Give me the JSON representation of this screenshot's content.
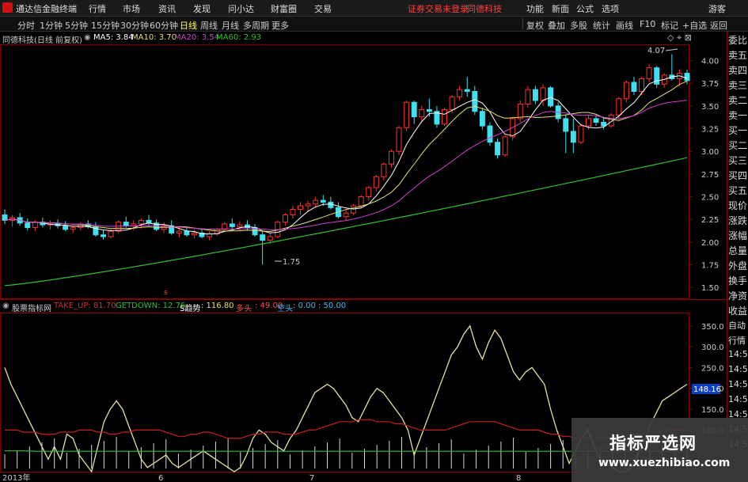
{
  "titlebar": {
    "app_name": "通达信金融终端",
    "menu": [
      "行情",
      "市场",
      "资讯",
      "发现",
      "问小达",
      "财富圈",
      "交易"
    ],
    "notice": "证券交易未登录",
    "stock": "同德科技",
    "right_menu": [
      "功能",
      "新面",
      "公式",
      "选项"
    ],
    "guest": "游客",
    "accent": "#d01010"
  },
  "toolbar": {
    "periods": [
      "分时",
      "1分钟",
      "5分钟",
      "15分钟",
      "30分钟",
      "60分钟",
      "日线",
      "周线",
      "月线",
      "多周期",
      "更多"
    ],
    "active": "日线",
    "right": [
      "复权",
      "叠加",
      "多股",
      "统计",
      "画线",
      "F10",
      "标记",
      "+自选",
      "返回"
    ]
  },
  "main_legend": {
    "title": "同德科技(日线 前复权)",
    "ma5": "MA5: 3.84",
    "ma10": "MA10: 3.70",
    "ma20": "MA20: 3.54",
    "ma60": "MA60: 2.93",
    "colors": {
      "ma5": "#ffffff",
      "ma10": "#e8e070",
      "ma20": "#d040d0",
      "ma60": "#30c030"
    }
  },
  "indicator_legend": {
    "title": "股票指标网",
    "take_up": "TAKE_UP: 81.70",
    "getdown": "GETDOWN: 12.76",
    "trend_label": "S趋势",
    "trend": ": 116.80",
    "duotou_label": "多头",
    "duotou": ": 49.00",
    "kongtou_label": "空头",
    "kongtou": ": 0.00 : 50.00"
  },
  "annotations": {
    "high": "4.07",
    "low": "1.75",
    "price_tag": "148.16"
  },
  "x_labels": [
    "2013年",
    "6",
    "7",
    "8"
  ],
  "right_panel": [
    "委比",
    "卖五",
    "卖四",
    "卖三",
    "卖二",
    "卖一",
    "买一",
    "买二",
    "买三",
    "买四",
    "买五",
    "现价",
    "涨跌",
    "涨幅",
    "总量",
    "外盘",
    "换手",
    "净资",
    "收益",
    "自动",
    "行情",
    "14:5",
    "14:5",
    "14:5",
    "14:5",
    "14:5",
    "14:5",
    "14:5"
  ],
  "banner": {
    "line1": "指标严选网",
    "line2": "www.xuezhibiao.com"
  },
  "chart_data": [
    {
      "type": "candlestick",
      "yaxis_ticks": [
        "4.00",
        "3.75",
        "3.50",
        "3.25",
        "3.00",
        "2.75",
        "2.50",
        "2.25",
        "2.00",
        "1.75",
        "1.50"
      ],
      "ylim": [
        1.38,
        4.17
      ],
      "ohlc": [
        [
          2.3,
          2.36,
          2.2,
          2.24
        ],
        [
          2.24,
          2.3,
          2.17,
          2.27
        ],
        [
          2.27,
          2.32,
          2.18,
          2.21
        ],
        [
          2.21,
          2.26,
          2.13,
          2.16
        ],
        [
          2.16,
          2.24,
          2.12,
          2.22
        ],
        [
          2.22,
          2.27,
          2.16,
          2.19
        ],
        [
          2.19,
          2.24,
          2.14,
          2.2
        ],
        [
          2.2,
          2.25,
          2.15,
          2.18
        ],
        [
          2.18,
          2.23,
          2.12,
          2.14
        ],
        [
          2.14,
          2.18,
          2.1,
          2.16
        ],
        [
          2.16,
          2.22,
          2.13,
          2.2
        ],
        [
          2.2,
          2.24,
          2.15,
          2.17
        ],
        [
          2.17,
          2.22,
          2.06,
          2.08
        ],
        [
          2.08,
          2.13,
          2.03,
          2.06
        ],
        [
          2.06,
          2.14,
          2.04,
          2.12
        ],
        [
          2.12,
          2.24,
          2.1,
          2.22
        ],
        [
          2.22,
          2.28,
          2.16,
          2.18
        ],
        [
          2.18,
          2.24,
          2.13,
          2.2
        ],
        [
          2.2,
          2.26,
          2.15,
          2.24
        ],
        [
          2.24,
          2.3,
          2.18,
          2.21
        ],
        [
          2.21,
          2.25,
          2.12,
          2.14
        ],
        [
          2.14,
          2.22,
          2.1,
          2.18
        ],
        [
          2.18,
          2.24,
          2.08,
          2.1
        ],
        [
          2.1,
          2.16,
          2.05,
          2.12
        ],
        [
          2.12,
          2.17,
          2.06,
          2.08
        ],
        [
          2.08,
          2.14,
          2.04,
          2.1
        ],
        [
          2.1,
          2.15,
          2.04,
          2.06
        ],
        [
          2.06,
          2.12,
          2.02,
          2.09
        ],
        [
          2.09,
          2.16,
          2.07,
          2.14
        ],
        [
          2.14,
          2.22,
          2.12,
          2.2
        ],
        [
          2.2,
          2.26,
          2.14,
          2.17
        ],
        [
          2.17,
          2.23,
          2.12,
          2.19
        ],
        [
          2.19,
          2.24,
          2.13,
          2.16
        ],
        [
          2.16,
          2.2,
          2.06,
          2.08
        ],
        [
          2.08,
          2.13,
          1.75,
          2.02
        ],
        [
          2.02,
          2.1,
          1.98,
          2.06
        ],
        [
          2.06,
          2.24,
          2.04,
          2.22
        ],
        [
          2.22,
          2.32,
          2.18,
          2.3
        ],
        [
          2.3,
          2.4,
          2.26,
          2.36
        ],
        [
          2.36,
          2.44,
          2.3,
          2.4
        ],
        [
          2.4,
          2.46,
          2.34,
          2.42
        ],
        [
          2.42,
          2.5,
          2.38,
          2.46
        ],
        [
          2.46,
          2.52,
          2.4,
          2.44
        ],
        [
          2.44,
          2.5,
          2.36,
          2.38
        ],
        [
          2.38,
          2.44,
          2.26,
          2.28
        ],
        [
          2.28,
          2.36,
          2.24,
          2.32
        ],
        [
          2.32,
          2.42,
          2.3,
          2.4
        ],
        [
          2.4,
          2.52,
          2.38,
          2.5
        ],
        [
          2.5,
          2.62,
          2.46,
          2.6
        ],
        [
          2.6,
          2.74,
          2.56,
          2.72
        ],
        [
          2.72,
          2.88,
          2.68,
          2.86
        ],
        [
          2.86,
          3.02,
          2.82,
          3.0
        ],
        [
          3.0,
          3.28,
          2.96,
          3.26
        ],
        [
          3.26,
          3.56,
          3.22,
          3.54
        ],
        [
          3.54,
          3.56,
          3.3,
          3.38
        ],
        [
          3.38,
          3.5,
          3.32,
          3.46
        ],
        [
          3.46,
          3.58,
          3.38,
          3.44
        ],
        [
          3.44,
          3.5,
          3.26,
          3.3
        ],
        [
          3.3,
          3.48,
          3.28,
          3.46
        ],
        [
          3.46,
          3.62,
          3.42,
          3.6
        ],
        [
          3.6,
          3.72,
          3.56,
          3.68
        ],
        [
          3.68,
          3.82,
          3.6,
          3.66
        ],
        [
          3.66,
          3.72,
          3.4,
          3.44
        ],
        [
          3.44,
          3.48,
          3.24,
          3.28
        ],
        [
          3.28,
          3.32,
          3.06,
          3.1
        ],
        [
          3.1,
          3.14,
          2.92,
          2.96
        ],
        [
          2.96,
          3.18,
          2.94,
          3.16
        ],
        [
          3.16,
          3.38,
          3.12,
          3.36
        ],
        [
          3.36,
          3.56,
          3.32,
          3.52
        ],
        [
          3.52,
          3.72,
          3.48,
          3.68
        ],
        [
          3.68,
          3.72,
          3.52,
          3.56
        ],
        [
          3.56,
          3.74,
          3.5,
          3.7
        ],
        [
          3.7,
          3.72,
          3.48,
          3.5
        ],
        [
          3.5,
          3.54,
          3.32,
          3.36
        ],
        [
          3.36,
          3.4,
          2.98,
          3.22
        ],
        [
          3.22,
          3.36,
          2.98,
          3.1
        ],
        [
          3.1,
          3.3,
          3.08,
          3.28
        ],
        [
          3.28,
          3.4,
          3.24,
          3.36
        ],
        [
          3.36,
          3.4,
          3.28,
          3.32
        ],
        [
          3.32,
          3.38,
          3.24,
          3.28
        ],
        [
          3.28,
          3.42,
          3.26,
          3.4
        ],
        [
          3.4,
          3.6,
          3.36,
          3.58
        ],
        [
          3.58,
          3.78,
          3.54,
          3.76
        ],
        [
          3.76,
          3.82,
          3.62,
          3.66
        ],
        [
          3.66,
          3.82,
          3.62,
          3.8
        ],
        [
          3.8,
          3.96,
          3.76,
          3.92
        ],
        [
          3.92,
          3.94,
          3.7,
          3.74
        ],
        [
          3.74,
          3.86,
          3.7,
          3.84
        ],
        [
          3.84,
          4.07,
          3.78,
          3.8
        ],
        [
          3.8,
          3.9,
          3.72,
          3.86
        ],
        [
          3.86,
          3.9,
          3.74,
          3.78
        ]
      ]
    },
    {
      "type": "line",
      "yaxis_ticks": [
        "350.0",
        "300.0",
        "250.0",
        "200.0",
        "150.0",
        "100.0"
      ],
      "ylim": [
        0,
        380
      ],
      "series": [
        {
          "name": "TAKE_UP",
          "values": [
            250,
            210,
            180,
            150,
            120,
            90,
            60,
            30,
            60,
            30,
            90,
            80,
            40,
            20,
            0,
            60,
            120,
            150,
            170,
            150,
            110,
            70,
            30,
            10,
            20,
            30,
            40,
            20,
            10,
            20,
            30,
            40,
            50,
            40,
            30,
            20,
            10,
            0,
            10,
            40,
            80,
            100,
            90,
            70,
            60,
            50,
            80,
            100,
            130,
            160,
            190,
            200,
            210,
            200,
            180,
            160,
            130,
            120,
            150,
            180,
            200,
            190,
            170,
            150,
            130,
            100,
            40,
            80,
            120,
            160,
            200,
            240,
            280,
            300,
            330,
            350,
            300,
            270,
            310,
            340,
            320,
            280,
            240,
            220,
            240,
            250,
            230,
            210,
            150,
            100,
            60,
            20,
            50,
            80,
            100,
            60,
            30,
            20,
            10,
            0,
            0,
            10,
            40,
            70,
            110,
            140,
            170,
            180,
            190,
            200,
            210
          ]
        },
        {
          "name": "GETDOWN",
          "values": [
            100,
            100,
            100,
            95,
            95,
            95,
            90,
            90,
            90,
            95,
            95,
            95,
            100,
            100,
            100,
            95,
            95,
            90,
            90,
            95,
            95,
            100,
            100,
            100,
            100,
            100,
            95,
            90,
            85,
            85,
            90,
            90,
            95,
            95,
            90,
            85,
            80,
            80,
            80,
            85,
            90,
            90,
            95,
            95,
            95,
            90,
            90,
            90,
            95,
            100,
            100,
            105,
            110,
            115,
            120,
            120,
            120,
            125,
            125,
            125,
            120,
            120,
            120,
            115,
            115,
            110,
            105,
            100,
            100,
            100,
            100,
            100,
            105,
            110,
            115,
            120,
            120,
            120,
            120,
            120,
            115,
            110,
            105,
            100,
            100,
            100,
            100,
            95,
            90,
            90,
            85,
            85,
            80,
            80,
            80,
            80,
            80,
            80,
            85,
            85,
            85,
            90,
            90,
            90,
            95,
            95,
            95,
            100,
            100,
            100,
            100
          ]
        },
        {
          "name": "多头",
          "values": [
            50,
            50,
            50,
            50,
            50,
            49,
            49,
            49,
            49,
            49,
            49,
            49,
            49,
            49,
            49,
            49,
            49,
            49,
            49,
            49,
            49,
            49,
            49,
            49,
            49,
            49,
            49,
            49,
            49,
            49,
            49,
            49,
            49,
            49,
            49,
            49,
            49,
            49,
            49,
            49,
            49,
            49,
            49,
            49,
            49,
            49,
            49,
            49,
            49,
            49,
            49,
            49,
            49,
            49,
            49,
            49,
            49,
            49,
            49,
            49,
            49,
            49,
            49,
            49,
            49,
            49,
            49,
            49,
            49,
            49,
            49,
            49,
            49,
            49,
            49,
            49,
            49,
            49,
            49,
            49,
            49,
            49,
            49,
            49,
            49,
            49,
            49,
            49,
            49,
            49,
            49,
            49,
            49,
            49,
            49,
            49,
            49,
            49,
            49,
            49,
            49,
            49,
            49,
            49,
            49,
            49,
            49,
            49,
            49,
            49,
            49
          ]
        }
      ]
    }
  ]
}
